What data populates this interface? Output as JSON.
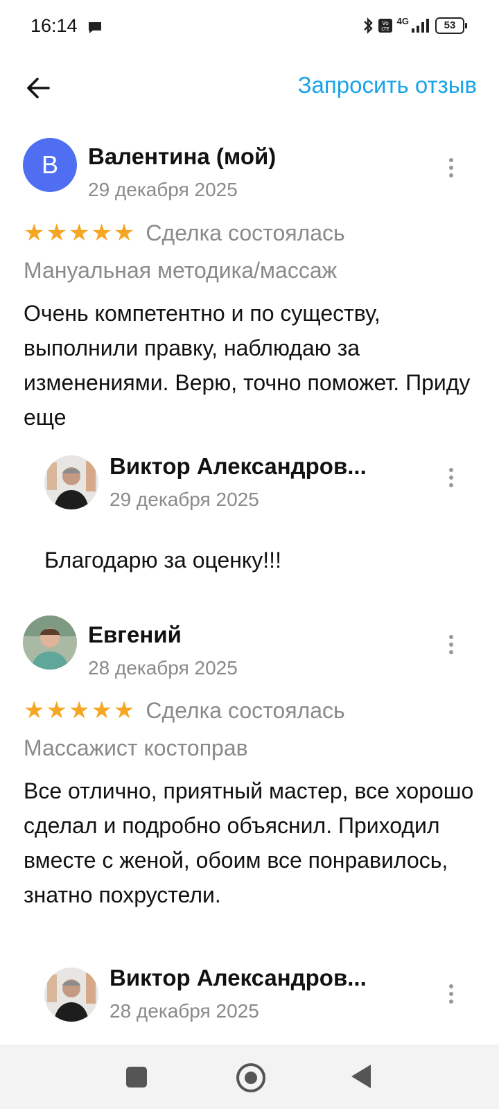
{
  "status_bar": {
    "time": "16:14",
    "network": "4G",
    "battery": "53",
    "icons": [
      "message-icon",
      "bluetooth-icon",
      "volte-icon",
      "signal-icon",
      "battery-icon"
    ]
  },
  "app_bar": {
    "back_icon": "arrow-left-icon",
    "request_review_label": "Запросить отзыв"
  },
  "colors": {
    "accent": "#1aa3e8",
    "star": "#f5a623",
    "avatar_bg": "#4f6ef2",
    "muted_text": "#8a8a8a"
  },
  "reviews": [
    {
      "avatar_letter": "В",
      "author": "Валентина (мой)",
      "date": "29 декабря 2025",
      "rating": 5,
      "stars": "★★★★★",
      "deal_status": "Сделка состоялась",
      "service": "Мануальная методика/массаж",
      "text": "Очень компетентно и по существу, выполнили правку, наблюдаю за изменениями. Верю, точно поможет. Приду еще",
      "reply": {
        "author": "Виктор Александров...",
        "date": "29 декабря 2025",
        "text": "Благодарю за оценку!!!"
      }
    },
    {
      "author": "Евгений",
      "date": "28 декабря 2025",
      "rating": 5,
      "stars": "★★★★★",
      "deal_status": "Сделка состоялась",
      "service": "Массажист костоправ",
      "text": "Все отлично, приятный мастер, все хорошо сделал и подробно объяснил. Приходил вместе с женой, обоим все понравилось, знатно похрустели.",
      "reply": {
        "author": "Виктор Александров...",
        "date": "28 декабря 2025"
      }
    }
  ],
  "nav_bar": {
    "icons": [
      "recents-square-icon",
      "home-circle-icon",
      "back-triangle-icon"
    ]
  }
}
